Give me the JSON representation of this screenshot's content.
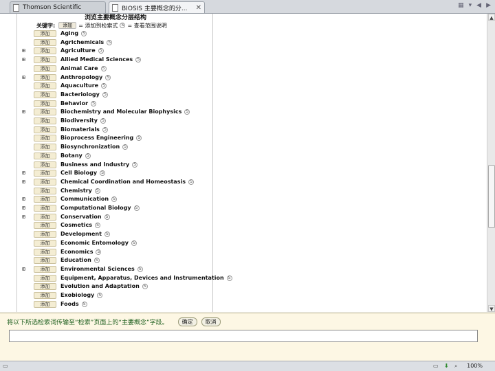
{
  "tabs": [
    {
      "title": "Thomson Scientific",
      "active": false
    },
    {
      "title": "BIOSIS 主要概念的分...",
      "active": true
    }
  ],
  "panel": {
    "title": "浏览主要概念分层结构",
    "header_keyword": "关键字:",
    "header_mini_button": "添加",
    "header_add_hint": "= 添加到检索式",
    "header_scope_hint": "= 查看范围说明",
    "add_label": "添加",
    "info_glyph": "S"
  },
  "concepts": [
    {
      "label": "Aging",
      "expandable": false
    },
    {
      "label": "Agrichemicals",
      "expandable": false
    },
    {
      "label": "Agriculture",
      "expandable": true
    },
    {
      "label": "Allied Medical Sciences",
      "expandable": true
    },
    {
      "label": "Animal Care",
      "expandable": false
    },
    {
      "label": "Anthropology",
      "expandable": true
    },
    {
      "label": "Aquaculture",
      "expandable": false
    },
    {
      "label": "Bacteriology",
      "expandable": false
    },
    {
      "label": "Behavior",
      "expandable": false
    },
    {
      "label": "Biochemistry and Molecular Biophysics",
      "expandable": true
    },
    {
      "label": "Biodiversity",
      "expandable": false
    },
    {
      "label": "Biomaterials",
      "expandable": false
    },
    {
      "label": "Bioprocess Engineering",
      "expandable": false
    },
    {
      "label": "Biosynchronization",
      "expandable": false
    },
    {
      "label": "Botany",
      "expandable": false
    },
    {
      "label": "Business and Industry",
      "expandable": false
    },
    {
      "label": "Cell Biology",
      "expandable": true
    },
    {
      "label": "Chemical Coordination and Homeostasis",
      "expandable": true
    },
    {
      "label": "Chemistry",
      "expandable": false
    },
    {
      "label": "Communication",
      "expandable": true
    },
    {
      "label": "Computational Biology",
      "expandable": true
    },
    {
      "label": "Conservation",
      "expandable": true
    },
    {
      "label": "Cosmetics",
      "expandable": false
    },
    {
      "label": "Development",
      "expandable": false
    },
    {
      "label": "Economic Entomology",
      "expandable": false
    },
    {
      "label": "Economics",
      "expandable": false
    },
    {
      "label": "Education",
      "expandable": false
    },
    {
      "label": "Environmental Sciences",
      "expandable": true
    },
    {
      "label": "Equipment, Apparatus, Devices and Instrumentation",
      "expandable": false
    },
    {
      "label": "Evolution and Adaptation",
      "expandable": false
    },
    {
      "label": "Exobiology",
      "expandable": false
    },
    {
      "label": "Foods",
      "expandable": false
    }
  ],
  "expand_glyph": "⊞",
  "bottom": {
    "instruction": "将以下所选检索词传输至“检索”页面上的“主要概念”字段。",
    "ok_label": "确定",
    "cancel_label": "取消",
    "input_value": ""
  },
  "status": {
    "zoom": "100%"
  },
  "colors": {
    "instruction": "#206020",
    "bottom_bg": "#fdf7e4",
    "add_button_bg": "#f4edd3"
  }
}
